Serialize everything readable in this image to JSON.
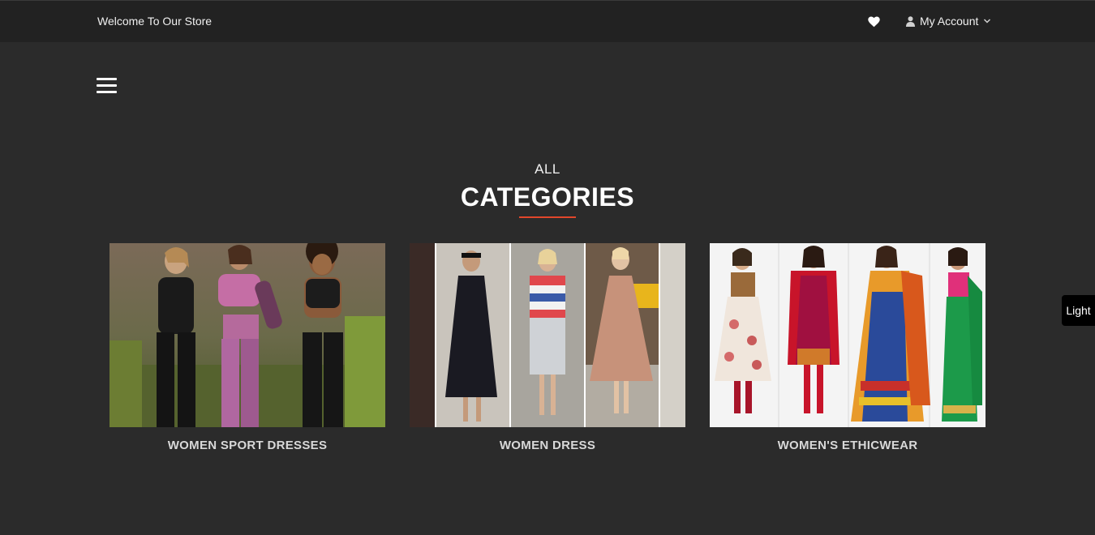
{
  "topbar": {
    "welcome_text": "Welcome To Our Store",
    "wishlist_icon": "heart-icon",
    "account_label": "My Account",
    "account_icon": "user-icon",
    "account_dropdown_icon": "chevron-down-icon"
  },
  "nav": {
    "menu_icon": "hamburger-menu-icon"
  },
  "section": {
    "small_title": "ALL",
    "big_title": "CATEGORIES",
    "accent_color": "#e2472b"
  },
  "categories": [
    {
      "label": "WOMEN SPORT DRESSES"
    },
    {
      "label": "WOMEN DRESS"
    },
    {
      "label": "WOMEN'S ETHICWEAR"
    }
  ],
  "theme_toggle": {
    "label": "Light"
  },
  "colors": {
    "background": "#2b2b2b",
    "topbar": "#222222",
    "accent": "#e2472b"
  }
}
